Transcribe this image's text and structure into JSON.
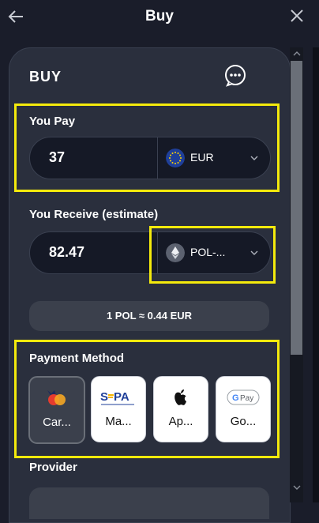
{
  "header": {
    "title": "Buy"
  },
  "card": {
    "heading": "BUY"
  },
  "you_pay": {
    "label": "You Pay",
    "amount": "37",
    "currency": "EUR"
  },
  "you_receive": {
    "label": "You Receive (estimate)",
    "amount": "82.47",
    "currency": "POL-..."
  },
  "rate": {
    "text": "1 POL ≈ 0.44 EUR"
  },
  "payment_method": {
    "label": "Payment Method",
    "options": [
      {
        "label": "Car...",
        "icon": "card-icon",
        "selected": true
      },
      {
        "label": "Ma...",
        "icon": "sepa-icon",
        "selected": false
      },
      {
        "label": "Ap...",
        "icon": "apple-icon",
        "selected": false
      },
      {
        "label": "Go...",
        "icon": "google-pay-icon",
        "selected": false
      }
    ]
  },
  "provider": {
    "label": "Provider"
  },
  "colors": {
    "background": "#1a1d2a",
    "card": "#2a2f3d",
    "highlight": "#f4ea0c",
    "input": "#151926"
  }
}
